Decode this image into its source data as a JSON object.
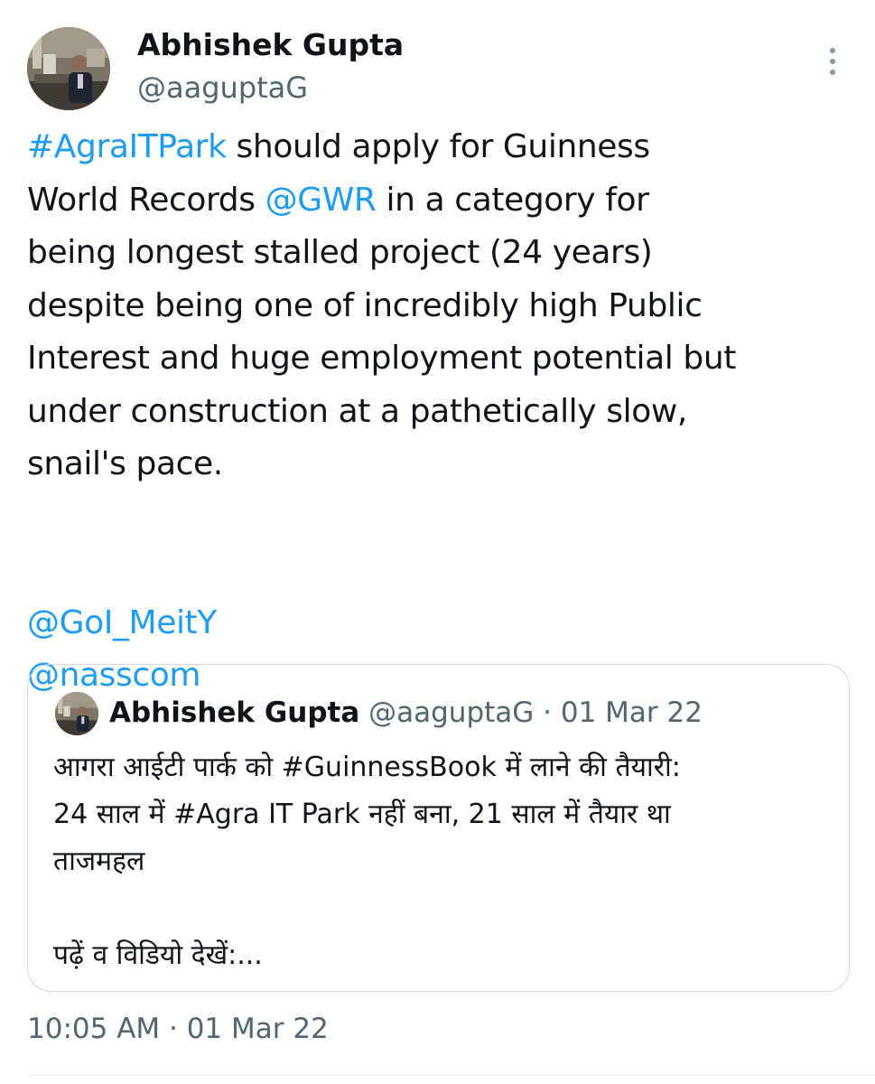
{
  "author": {
    "name": "Abhishek Gupta",
    "handle": "@aaguptaG"
  },
  "tweet": {
    "lines": [
      [
        {
          "text": "#AgraITPark",
          "link": true
        },
        {
          "text": " should apply for Guinness",
          "link": false
        }
      ],
      [
        {
          "text": "World Records ",
          "link": false
        },
        {
          "text": "@GWR",
          "link": true
        },
        {
          "text": " in a category for",
          "link": false
        }
      ],
      [
        {
          "text": "being longest stalled project (24 years)",
          "link": false
        }
      ],
      [
        {
          "text": "despite being one of incredibly high Public",
          "link": false
        }
      ],
      [
        {
          "text": "Interest and huge employment potential but",
          "link": false
        }
      ],
      [
        {
          "text": "under construction at a pathetically slow,",
          "link": false
        }
      ],
      [
        {
          "text": "snail's pace.",
          "link": false
        }
      ]
    ],
    "mentions": [
      "@GoI_MeitY",
      "@nasscom"
    ]
  },
  "quote": {
    "name": "Abhishek Gupta",
    "handle": "@aaguptaG",
    "separator": " · ",
    "date": "01 Mar 22",
    "lines": [
      "आगरा आईटी पार्क को #GuinnessBook में लाने की तैयारी:",
      "24 साल में #Agra IT Park नहीं बना, 21 साल में तैयार था",
      "ताजमहल"
    ],
    "tail": "पढ़ें व विडियो देखें:..."
  },
  "timestamp": "10:05 AM · 01 Mar 22",
  "colors": {
    "link": "#1d9bf0",
    "secondary_text": "#536471",
    "primary_text": "#0f1419",
    "border": "#cfd9de"
  },
  "icons": {
    "more": "more-vertical-icon",
    "avatar": "profile-photo"
  }
}
